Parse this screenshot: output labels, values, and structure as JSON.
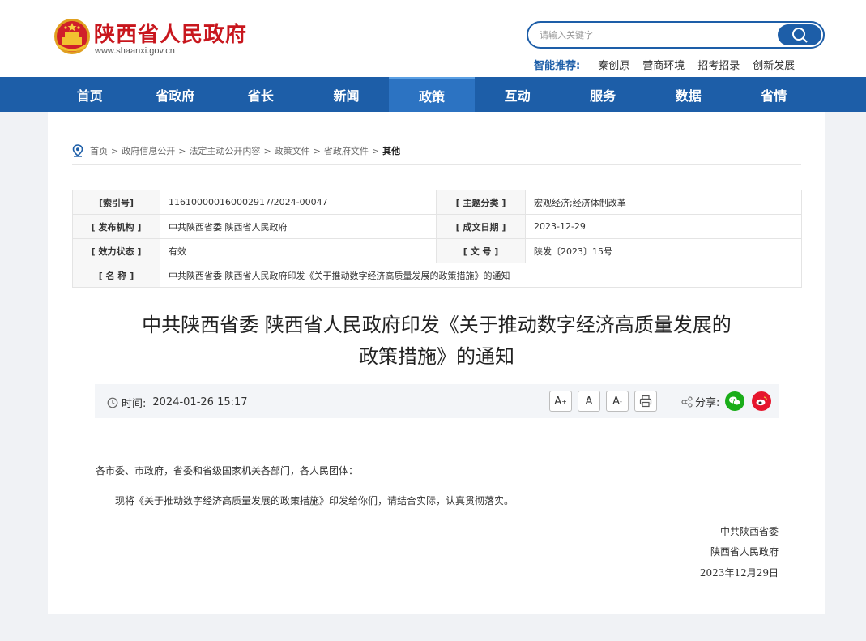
{
  "header": {
    "site_title": "陕西省人民政府",
    "site_domain": "www.shaanxi.gov.cn",
    "search_placeholder": "请输入关键字",
    "hot_label": "智能推荐:",
    "hot_items": [
      "秦创原",
      "营商环境",
      "招考招录",
      "创新发展"
    ]
  },
  "nav": {
    "items": [
      "首页",
      "省政府",
      "省长",
      "新闻",
      "政策",
      "互动",
      "服务",
      "数据",
      "省情"
    ],
    "active": "政策"
  },
  "breadcrumb": {
    "items": [
      "首页",
      "政府信息公开",
      "法定主动公开内容",
      "政策文件",
      "省政府文件"
    ],
    "current": "其他"
  },
  "meta": {
    "index_label": "[索引号]",
    "index_value": "116100000160002917/2024-00047",
    "topic_label": "[ 主题分类 ]",
    "topic_value": "宏观经济;经济体制改革",
    "issuer_label": "[ 发布机构 ]",
    "issuer_value": "中共陕西省委 陕西省人民政府",
    "date_label": "[ 成文日期 ]",
    "date_value": "2023-12-29",
    "status_label": "[ 效力状态 ]",
    "status_value": "有效",
    "docno_label": "[ 文 号 ]",
    "docno_value": "陕发〔2023〕15号",
    "name_label": "[ 名 称 ]",
    "name_value": "中共陕西省委 陕西省人民政府印发《关于推动数字经济高质量发展的政策措施》的通知"
  },
  "article": {
    "title_line1": "中共陕西省委 陕西省人民政府印发《关于推动数字经济高质量发展的",
    "title_line2": "政策措施》的通知",
    "time_label": "时间:",
    "time_value": "2024-01-26 15:17",
    "font_large": "A",
    "font_normal": "A",
    "font_small": "A",
    "share_label": "分享:",
    "salutation": "各市委、市政府，省委和省级国家机关各部门，各人民团体：",
    "paragraph": "现将《关于推动数字经济高质量发展的政策措施》印发给你们，请结合实际，认真贯彻落实。",
    "sign_org1": "中共陕西省委",
    "sign_org2": "陕西省人民政府",
    "sign_date": "2023年12月29日"
  },
  "colors": {
    "brand_red": "#c8161d",
    "nav_blue": "#1d5ea8",
    "wechat_green": "#1aad19",
    "weibo_red": "#e6162d"
  }
}
